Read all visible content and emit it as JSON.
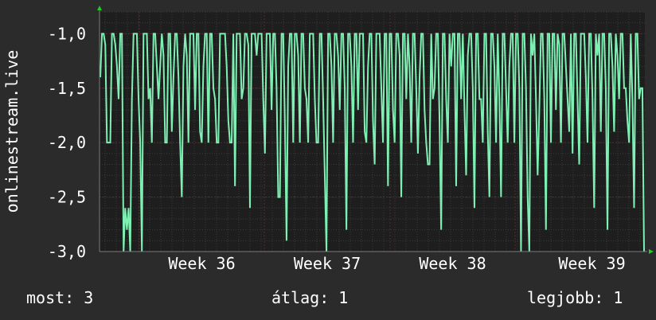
{
  "chart_data": {
    "type": "line",
    "ylabel": "onlinestream.live",
    "xlabel": "",
    "title": "",
    "ylim": [
      -3.0,
      -0.8
    ],
    "y_ticks": [
      -1.0,
      -1.5,
      -2.0,
      -2.5,
      -3.0
    ],
    "y_tick_labels": [
      "-1,0",
      "-1,5",
      "-2,0",
      "-2,5",
      "-3,0"
    ],
    "x_tick_labels": [
      "Week 36",
      "Week 37",
      "Week 38",
      "Week 39"
    ],
    "grid": true,
    "colors": {
      "background": "#2b2b2b",
      "plot": "#1e1e1e",
      "line": "#7ff0b4",
      "grid": "#5a2a2a",
      "axis_arrow": "#22cc22"
    },
    "series": [
      {
        "values": [
          -1.4,
          -1,
          -1,
          -1.1,
          -2,
          -2,
          -2,
          -1,
          -1,
          -1.1,
          -1.3,
          -1.6,
          -1,
          -1,
          -3,
          -2.6,
          -2.8,
          -2.6,
          -3,
          -1.6,
          -1,
          -1,
          -1,
          -1.6,
          -2,
          -3,
          -1,
          -1,
          -1,
          -1.6,
          -1.5,
          -2,
          -1,
          -1,
          -1.3,
          -1.6,
          -1.3,
          -1,
          -1.2,
          -2,
          -2,
          -1,
          -1,
          -1.9,
          -1.4,
          -1,
          -1,
          -1.4,
          -2,
          -2.5,
          -1.3,
          -1,
          -1.2,
          -2,
          -1,
          -1,
          -1,
          -1.7,
          -1,
          -1,
          -1.9,
          -2,
          -1.3,
          -1,
          -1,
          -2,
          -1,
          -1,
          -1.5,
          -1.6,
          -2,
          -2,
          -1,
          -1,
          -1,
          -1,
          -1.3,
          -1.8,
          -2,
          -2,
          -1,
          -2.4,
          -1,
          -1,
          -1,
          -1.6,
          -1.5,
          -1,
          -1,
          -1.1,
          -2.6,
          -1,
          -1,
          -1,
          -1.2,
          -1,
          -1,
          -1,
          -1.6,
          -2.1,
          -1,
          -1,
          -1,
          -1.7,
          -1,
          -1,
          -1.5,
          -2.5,
          -2.5,
          -1,
          -1,
          -1.8,
          -2.9,
          -1.3,
          -1,
          -1,
          -2,
          -1,
          -1,
          -1.2,
          -2,
          -1,
          -1,
          -1.5,
          -1.6,
          -2,
          -1,
          -1,
          -1,
          -1.6,
          -2,
          -2,
          -1,
          -1,
          -1.6,
          -2.3,
          -3,
          -1,
          -1,
          -1.3,
          -2,
          -1,
          -1,
          -1.2,
          -1.7,
          -1,
          -1,
          -1.5,
          -2.8,
          -1,
          -1,
          -1.3,
          -2,
          -1,
          -1,
          -1.7,
          -1,
          -1,
          -1,
          -1.9,
          -2,
          -1.3,
          -1,
          -1,
          -1.8,
          -2.2,
          -1,
          -1,
          -1,
          -1.5,
          -2,
          -1,
          -1,
          -2.4,
          -1,
          -1,
          -1.7,
          -2,
          -1,
          -1,
          -1.2,
          -2.5,
          -1,
          -1,
          -1.6,
          -1,
          -1.3,
          -2,
          -1,
          -1,
          -1.5,
          -2.1,
          -1.4,
          -1,
          -1,
          -1.7,
          -2,
          -2.2,
          -2.2,
          -1,
          -1.6,
          -1.5,
          -1,
          -1,
          -1.8,
          -2.8,
          -1,
          -1,
          -1.6,
          -2,
          -1,
          -1.3,
          -1,
          -1,
          -2.4,
          -1,
          -1,
          -1.6,
          -1,
          -1.7,
          -2.3,
          -1.2,
          -1,
          -1,
          -1.5,
          -2.6,
          -1,
          -1,
          -1.6,
          -1.6,
          -2,
          -1,
          -1,
          -1.9,
          -2.5,
          -1,
          -1,
          -1.3,
          -2,
          -1,
          -1.6,
          -2.5,
          -1,
          -1,
          -1.5,
          -2,
          -1.3,
          -1,
          -1,
          -2,
          -1,
          -1,
          -1.5,
          -3,
          -1,
          -1,
          -1.5,
          -2.5,
          -3,
          -1,
          -1.2,
          -1,
          -1.6,
          -2.3,
          -1.7,
          -1,
          -1,
          -1.6,
          -2.8,
          -1,
          -1,
          -2,
          -1,
          -1,
          -1.7,
          -1,
          -1.1,
          -2,
          -1,
          -1,
          -1.3,
          -1.6,
          -1.9,
          -1,
          -2.1,
          -1,
          -1,
          -1.6,
          -2.2,
          -1,
          -1,
          -1,
          -1.4,
          -2,
          -1,
          -1,
          -1.6,
          -2.6,
          -1,
          -1.2,
          -1,
          -1.9,
          -1,
          -1,
          -1.5,
          -2.8,
          -1,
          -1,
          -1.3,
          -1.9,
          -1,
          -1.2,
          -1.6,
          -1,
          -1,
          -1.5,
          -1.5,
          -1.8,
          -2,
          -1,
          -1.6,
          -2.6,
          -1,
          -1,
          -1.6,
          -1.5,
          -1.5,
          -3
        ],
        "color": "#7ff0b4"
      }
    ]
  },
  "footer": {
    "current": "most: 3",
    "average": "átlag: 1",
    "best": "legjobb: 1"
  }
}
